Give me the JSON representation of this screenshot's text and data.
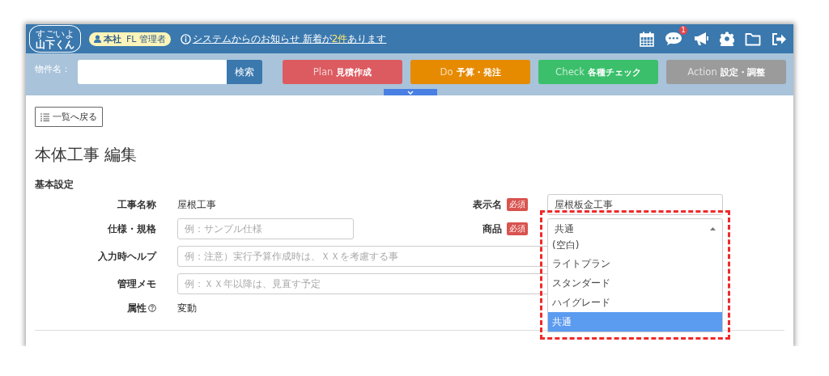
{
  "header": {
    "logo_top": "すごいよ",
    "logo_bottom": "山下くん",
    "user_badge": {
      "office": "本社",
      "role": "FL 管理者"
    },
    "notice": {
      "before": "システムからのお知らせ 新着が",
      "count": "2件",
      "after": "あります"
    },
    "message_count": "1"
  },
  "search": {
    "label": "物件名：",
    "button": "検索"
  },
  "phases": [
    {
      "en": "Plan",
      "ja": "見積作成",
      "color": "#dc5b60"
    },
    {
      "en": "Do",
      "ja": "予算・発注",
      "color": "#e68a00"
    },
    {
      "en": "Check",
      "ja": "各種チェック",
      "color": "#3bbf6b"
    },
    {
      "en": "Action",
      "ja": "設定・調整",
      "color": "#9b9b9b"
    }
  ],
  "back_button": "一覧へ戻る",
  "page_title": "本体工事 編集",
  "section_title": "基本設定",
  "form": {
    "construction_name": {
      "label": "工事名称",
      "value": "屋根工事"
    },
    "display_name": {
      "label": "表示名",
      "required": "必須",
      "value": "屋根板金工事"
    },
    "spec": {
      "label": "仕様・規格",
      "placeholder": "例：サンプル仕様"
    },
    "product": {
      "label": "商品",
      "required": "必須",
      "value": "共通",
      "expanded": true,
      "options": [
        {
          "label": "(空白)",
          "selected": false
        },
        {
          "label": "ライトプラン",
          "selected": false
        },
        {
          "label": "スタンダード",
          "selected": false
        },
        {
          "label": "ハイグレード",
          "selected": false
        },
        {
          "label": "共通",
          "selected": true
        }
      ]
    },
    "input_help": {
      "label": "入力時ヘルプ",
      "placeholder": "例：注意）実行予算作成時は、ＸＸを考慮する事"
    },
    "admin_memo": {
      "label": "管理メモ",
      "placeholder": "例：ＸＸ年以降は、見直す予定"
    },
    "attribute": {
      "label": "属性",
      "value": "変動"
    }
  }
}
